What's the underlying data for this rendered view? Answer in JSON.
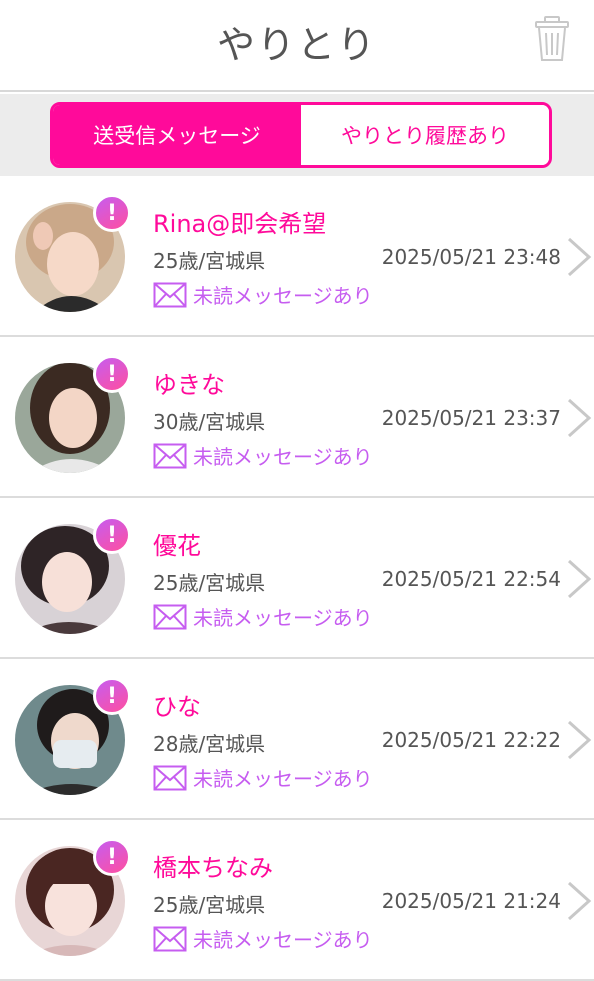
{
  "header": {
    "title": "やりとり",
    "trash_icon": "trash-icon"
  },
  "tabs": [
    {
      "label": "送受信メッセージ",
      "active": true
    },
    {
      "label": "やりとり履歴あり",
      "active": false
    }
  ],
  "colors": {
    "accent": "#ff0a9a",
    "status": "#c65df0",
    "text": "#555555"
  },
  "conversations": [
    {
      "name": "Rina@即会希望",
      "meta": "25歳/宮城県",
      "time": "2025/05/21 23:48",
      "status": "未読メッセージあり",
      "badge": "!"
    },
    {
      "name": "ゆきな",
      "meta": "30歳/宮城県",
      "time": "2025/05/21 23:37",
      "status": "未読メッセージあり",
      "badge": "!"
    },
    {
      "name": "優花",
      "meta": "25歳/宮城県",
      "time": "2025/05/21 22:54",
      "status": "未読メッセージあり",
      "badge": "!"
    },
    {
      "name": "ひな",
      "meta": "28歳/宮城県",
      "time": "2025/05/21 22:22",
      "status": "未読メッセージあり",
      "badge": "!"
    },
    {
      "name": "橋本ちなみ",
      "meta": "25歳/宮城県",
      "time": "2025/05/21 21:24",
      "status": "未読メッセージあり",
      "badge": "!"
    }
  ]
}
